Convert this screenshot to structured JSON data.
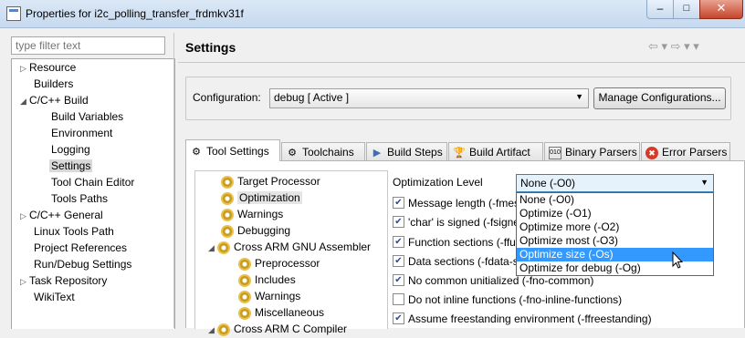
{
  "window": {
    "title": "Properties for i2c_polling_transfer_frdmkv31f",
    "min_glyph": "–",
    "max_glyph": "□",
    "close_glyph": "✕"
  },
  "filter": {
    "placeholder": "type filter text"
  },
  "tree": [
    {
      "label": "Resource",
      "twisty": "▷"
    },
    {
      "label": "Builders",
      "twisty": ""
    },
    {
      "label": "C/C++ Build",
      "twisty": "◢"
    },
    {
      "label": "Build Variables",
      "twisty": ""
    },
    {
      "label": "Environment",
      "twisty": ""
    },
    {
      "label": "Logging",
      "twisty": ""
    },
    {
      "label": "Settings",
      "twisty": ""
    },
    {
      "label": "Tool Chain Editor",
      "twisty": ""
    },
    {
      "label": "Tools Paths",
      "twisty": ""
    },
    {
      "label": "C/C++ General",
      "twisty": "▷"
    },
    {
      "label": "Linux Tools Path",
      "twisty": ""
    },
    {
      "label": "Project References",
      "twisty": ""
    },
    {
      "label": "Run/Debug Settings",
      "twisty": ""
    },
    {
      "label": "Task Repository",
      "twisty": "▷"
    },
    {
      "label": "WikiText",
      "twisty": ""
    }
  ],
  "page": {
    "title": "Settings",
    "nav": "⇦ ▾ ⇨ ▾ ▾"
  },
  "config": {
    "label": "Configuration:",
    "value": "debug  [ Active ]",
    "arrow": "▼",
    "manage_label": "Manage Configurations..."
  },
  "tabs": [
    {
      "label": "Tool Settings",
      "icon": "⚙"
    },
    {
      "label": "Toolchains",
      "icon": "⚙"
    },
    {
      "label": "Build Steps",
      "icon": "▶"
    },
    {
      "label": "Build Artifact",
      "icon": "🏆"
    },
    {
      "label": "Binary Parsers",
      "icon": "010"
    },
    {
      "label": "Error Parsers",
      "icon": "✖"
    }
  ],
  "tool_tree": [
    {
      "label": "Target Processor",
      "twisty": ""
    },
    {
      "label": "Optimization",
      "twisty": ""
    },
    {
      "label": "Warnings",
      "twisty": ""
    },
    {
      "label": "Debugging",
      "twisty": ""
    },
    {
      "label": "Cross ARM GNU Assembler",
      "twisty": "◢"
    },
    {
      "label": "Preprocessor",
      "twisty": ""
    },
    {
      "label": "Includes",
      "twisty": ""
    },
    {
      "label": "Warnings",
      "twisty": ""
    },
    {
      "label": "Miscellaneous",
      "twisty": ""
    },
    {
      "label": "Cross ARM C Compiler",
      "twisty": "◢"
    }
  ],
  "optimization": {
    "level_label": "Optimization Level",
    "selected": "None (-O0)",
    "arrow": "▼",
    "options": [
      "None (-O0)",
      "Optimize (-O1)",
      "Optimize more (-O2)",
      "Optimize most (-O3)",
      "Optimize size (-Os)",
      "Optimize for debug (-Og)"
    ],
    "highlighted": "Optimize size (-Os)",
    "checkboxes": [
      {
        "label": "Message length (-fmes",
        "checked": true
      },
      {
        "label": "'char' is signed (-fsigne",
        "checked": true
      },
      {
        "label": "Function sections (-ffu",
        "checked": true
      },
      {
        "label": "Data sections (-fdata-s",
        "checked": true
      },
      {
        "label": "No common unitialized (-fno-common)",
        "checked": true
      },
      {
        "label": "Do not inline functions (-fno-inline-functions)",
        "checked": false
      },
      {
        "label": "Assume freestanding environment (-ffreestanding)",
        "checked": true
      }
    ],
    "check_glyph": "✔"
  }
}
